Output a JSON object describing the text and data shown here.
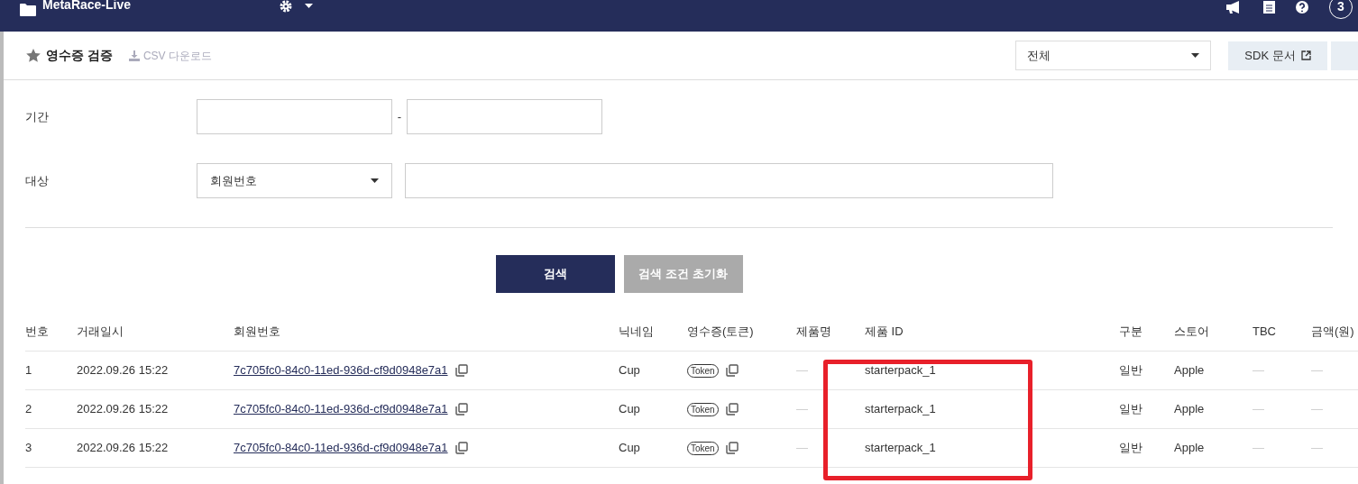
{
  "topbar": {
    "project": "MetaRace-Live",
    "notification_count": "3"
  },
  "header": {
    "title": "영수증 검증",
    "csv_link": "CSV 다운로드",
    "filter_value": "전체",
    "sdk_button": "SDK 문서"
  },
  "form": {
    "period_label": "기간",
    "period_separator": "-",
    "target_label": "대상",
    "target_value": "회원번호"
  },
  "buttons": {
    "search": "검색",
    "reset": "검색 조건 초기화"
  },
  "table": {
    "columns": [
      "번호",
      "거래일시",
      "회원번호",
      "닉네임",
      "영수증(토큰)",
      "제품명",
      "제품 ID",
      "구분",
      "스토어",
      "TBC",
      "금액(원)"
    ],
    "rows": [
      {
        "no": "1",
        "date": "2022.09.26 15:22",
        "member": "7c705fc0-84c0-11ed-936d-cf9d0948e7a1",
        "nickname": "Cup",
        "token": "Token",
        "product_name": "—",
        "product_id": "starterpack_1",
        "type": "일반",
        "store": "Apple",
        "tbc": "—",
        "amount": "—"
      },
      {
        "no": "2",
        "date": "2022.09.26 15:22",
        "member": "7c705fc0-84c0-11ed-936d-cf9d0948e7a1",
        "nickname": "Cup",
        "token": "Token",
        "product_name": "—",
        "product_id": "starterpack_1",
        "type": "일반",
        "store": "Apple",
        "tbc": "—",
        "amount": "—"
      },
      {
        "no": "3",
        "date": "2022.09.26 15:22",
        "member": "7c705fc0-84c0-11ed-936d-cf9d0948e7a1",
        "nickname": "Cup",
        "token": "Token",
        "product_name": "—",
        "product_id": "starterpack_1",
        "type": "일반",
        "store": "Apple",
        "tbc": "—",
        "amount": "—"
      }
    ]
  }
}
